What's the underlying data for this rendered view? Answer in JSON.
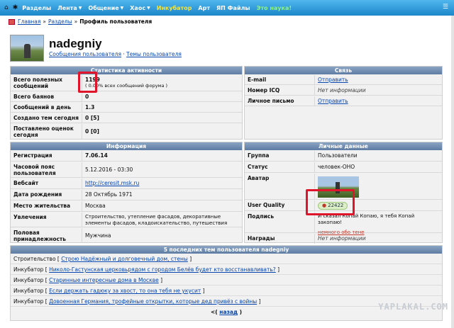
{
  "nav": {
    "items": [
      "Разделы",
      "Лента",
      "Общение",
      "Хаос",
      "Инкубатор",
      "Арт",
      "ЯП Файлы",
      "Это наука!"
    ]
  },
  "breadcrumb": {
    "home": "Главная",
    "sections": "Разделы",
    "current": "Профиль пользователя",
    "sep": "»"
  },
  "user": {
    "name": "nadegniy",
    "link_posts": "Сообщения пользователя",
    "link_sep": "·",
    "link_topics": "Темы пользователя"
  },
  "stats": {
    "title": "Статистика активности",
    "rows": [
      {
        "label": "Всего полезных сообщений",
        "value": "1199",
        "sub": "( 0.00% всех сообщений форума )"
      },
      {
        "label": "Всего баянов",
        "value": "0"
      },
      {
        "label": "Сообщений в день",
        "value": "1.3"
      },
      {
        "label": "Создано тем сегодня",
        "value": "0 [5]"
      },
      {
        "label": "Поставлено оценок сегодня",
        "value": "0 [0]"
      }
    ]
  },
  "contact": {
    "title": "Связь",
    "rows": [
      {
        "label": "E-mail",
        "value": "Отправить",
        "link": true
      },
      {
        "label": "Номер ICQ",
        "value": "Нет информации",
        "link": false
      },
      {
        "label": "Личное письмо",
        "value": "Отправить",
        "link": true
      }
    ]
  },
  "info": {
    "title": "Информация",
    "rows": [
      {
        "label": "Регистрация",
        "value": "7.06.14"
      },
      {
        "label": "Часовой пояс пользователя",
        "value": "5.12.2016 - 03:30"
      },
      {
        "label": "Вебсайт",
        "value": "http://ceresit.msk.ru"
      },
      {
        "label": "Дата рождения",
        "value": "28 Октябрь 1971"
      },
      {
        "label": "Место жительства",
        "value": "Москва"
      },
      {
        "label": "Увлечения",
        "value": "Строительство, утепление фасадов, декоративные элементы фасадов, кладоискательство, путешествия"
      },
      {
        "label": "Половая принадлежность",
        "value": "Мужчина"
      }
    ]
  },
  "personal": {
    "title": "Личные данные",
    "rows": [
      {
        "label": "Группа",
        "value": "Пользователи"
      },
      {
        "label": "Статус",
        "value": "человек-ОНО"
      },
      {
        "label": "Аватар",
        "value": ""
      },
      {
        "label": "User Quality",
        "value": "22422"
      },
      {
        "label": "Подпись",
        "value": "И сказал Копай Копаю, я тебя Копай закопаю!",
        "sub": "немного обо тене"
      },
      {
        "label": "Награды",
        "value": "Нет информации"
      }
    ]
  },
  "topics": {
    "title": "5 последних тем пользователя nadegniy",
    "items": [
      {
        "section": "Строительство",
        "title": "Строю Надёжный и долговечный дом, стены"
      },
      {
        "section": "Инкубатор",
        "title": "Николо-Гастунская церковьрядом с городом Белёв будет кто восстанавливать?"
      },
      {
        "section": "Инкубатор",
        "title": "Старинные интересные дома в Москве"
      },
      {
        "section": "Инкубатор",
        "title": "Если держать гадюку за хвост, то она тебя не укусит"
      },
      {
        "section": "Инкубатор",
        "title": "Довоенная Германия, трофейные открытки, которые дед привёз с войны"
      }
    ],
    "back": "назад",
    "back_prefix": "<("
  },
  "watermark": "YAPLAKAL.COM",
  "colors": {
    "nav_bg": "#1d86c9",
    "panel_head": "#6b88ad",
    "highlight": "#e0142a",
    "link": "#0645ad"
  }
}
